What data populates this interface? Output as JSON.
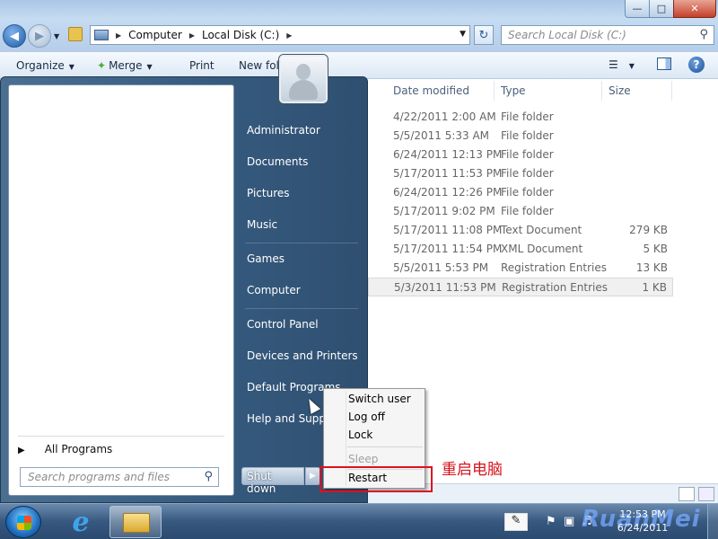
{
  "address": {
    "crumbs": [
      "Computer",
      "Local Disk (C:)"
    ],
    "search_placeholder": "Search Local Disk (C:)"
  },
  "toolbar": {
    "organize": "Organize",
    "merge": "Merge",
    "print": "Print",
    "new_folder": "New fol"
  },
  "columns": {
    "date_modified": "Date modified",
    "type": "Type",
    "size": "Size"
  },
  "files": [
    {
      "date": "4/22/2011 2:00 AM",
      "type": "File folder",
      "size": ""
    },
    {
      "date": "5/5/2011 5:33 AM",
      "type": "File folder",
      "size": ""
    },
    {
      "date": "6/24/2011 12:13 PM",
      "type": "File folder",
      "size": ""
    },
    {
      "date": "5/17/2011 11:53 PM",
      "type": "File folder",
      "size": ""
    },
    {
      "date": "6/24/2011 12:26 PM",
      "type": "File folder",
      "size": ""
    },
    {
      "date": "5/17/2011 9:02 PM",
      "type": "File folder",
      "size": ""
    },
    {
      "date": "5/17/2011 11:08 PM",
      "type": "Text Document",
      "size": "279 KB"
    },
    {
      "date": "5/17/2011 11:54 PM",
      "type": "XML Document",
      "size": "5 KB"
    },
    {
      "date": "5/5/2011 5:53 PM",
      "type": "Registration Entries",
      "size": "13 KB"
    },
    {
      "date": "5/3/2011 11:53 PM",
      "type": "Registration Entries",
      "size": "1 KB"
    }
  ],
  "start_menu": {
    "right_items": {
      "administrator": "Administrator",
      "documents": "Documents",
      "pictures": "Pictures",
      "music": "Music",
      "games": "Games",
      "computer": "Computer",
      "control_panel": "Control Panel",
      "devices_printers": "Devices and Printers",
      "default_programs": "Default Programs",
      "help_support": "Help and Suppor"
    },
    "all_programs": "All Programs",
    "search_placeholder": "Search programs and files",
    "shutdown": "Shut down"
  },
  "power_menu": {
    "switch_user": "Switch user",
    "log_off": "Log off",
    "lock": "Lock",
    "sleep": "Sleep",
    "restart": "Restart"
  },
  "annotation": "重启电脑",
  "taskbar": {
    "clock_time": "12:53 PM",
    "clock_date": "6/24/2011",
    "watermark": "RuanMei"
  },
  "colors": {
    "annotation_red": "#e0101d",
    "start_menu_blue": "#355a7e",
    "taskbar_blue": "#37587f"
  },
  "icons": [
    "back-arrow-icon",
    "forward-arrow-icon",
    "computer-icon",
    "refresh-icon",
    "search-icon",
    "help-icon",
    "user-picture-icon",
    "windows-orb-icon",
    "internet-explorer-icon",
    "explorer-folder-icon",
    "flag-icon",
    "network-icon",
    "volume-icon"
  ]
}
